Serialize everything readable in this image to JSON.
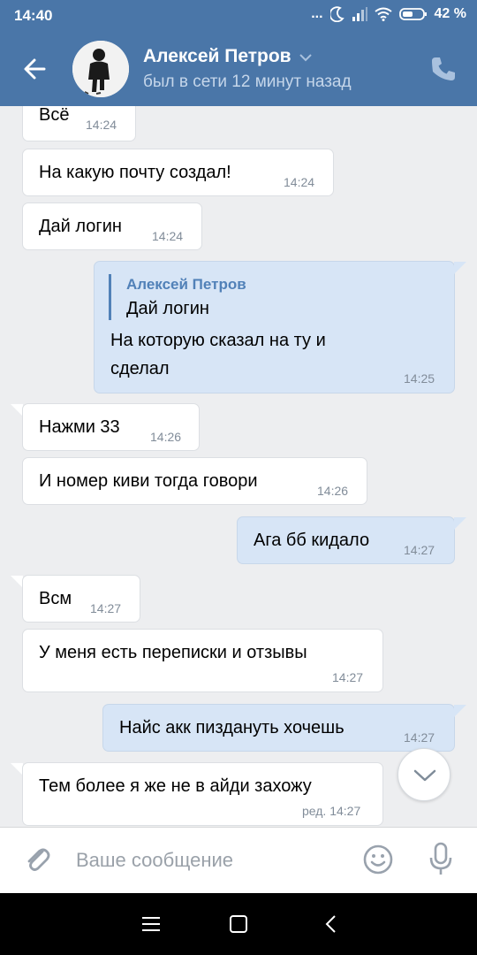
{
  "status": {
    "time": "14:40",
    "dots": "...",
    "battery": "42 %"
  },
  "header": {
    "name": "Алексей Петров",
    "subtitle": "был в сети 12 минут назад"
  },
  "messages": [
    {
      "text": "Всё",
      "time": "14:24"
    },
    {
      "text": "На какую почту создал!",
      "time": "14:24"
    },
    {
      "text": "Дай логин",
      "time": "14:24"
    },
    {
      "reply_name": "Алексей Петров",
      "reply_text": "Дай логин",
      "text_line1": "На которую сказал на ту и",
      "text_line2": "сделал",
      "time": "14:25"
    },
    {
      "text": "Нажми 33",
      "time": "14:26"
    },
    {
      "text": "И номер киви тогда говори",
      "time": "14:26"
    },
    {
      "text": "Ага бб кидало",
      "time": "14:27"
    },
    {
      "text": "Всм",
      "time": "14:27"
    },
    {
      "text": "У меня есть переписки и отзывы",
      "time": "14:27"
    },
    {
      "text": "Найс акк пиздануть хочешь",
      "time": "14:27"
    },
    {
      "text": "Тем более я же не в айди захожу",
      "time": "ред. 14:27"
    }
  ],
  "input": {
    "placeholder": "Ваше сообщение"
  },
  "colors": {
    "header": "#4a76a8",
    "background": "#edeef0",
    "outgoing": "#d7e5f6",
    "incoming": "#ffffff",
    "accent": "#5181b8"
  },
  "icons": [
    "back-arrow-icon",
    "chevron-down-icon",
    "phone-icon",
    "chevron-down-icon",
    "paperclip-icon",
    "smile-icon",
    "microphone-icon",
    "menu-icon",
    "square-icon",
    "back-icon"
  ]
}
